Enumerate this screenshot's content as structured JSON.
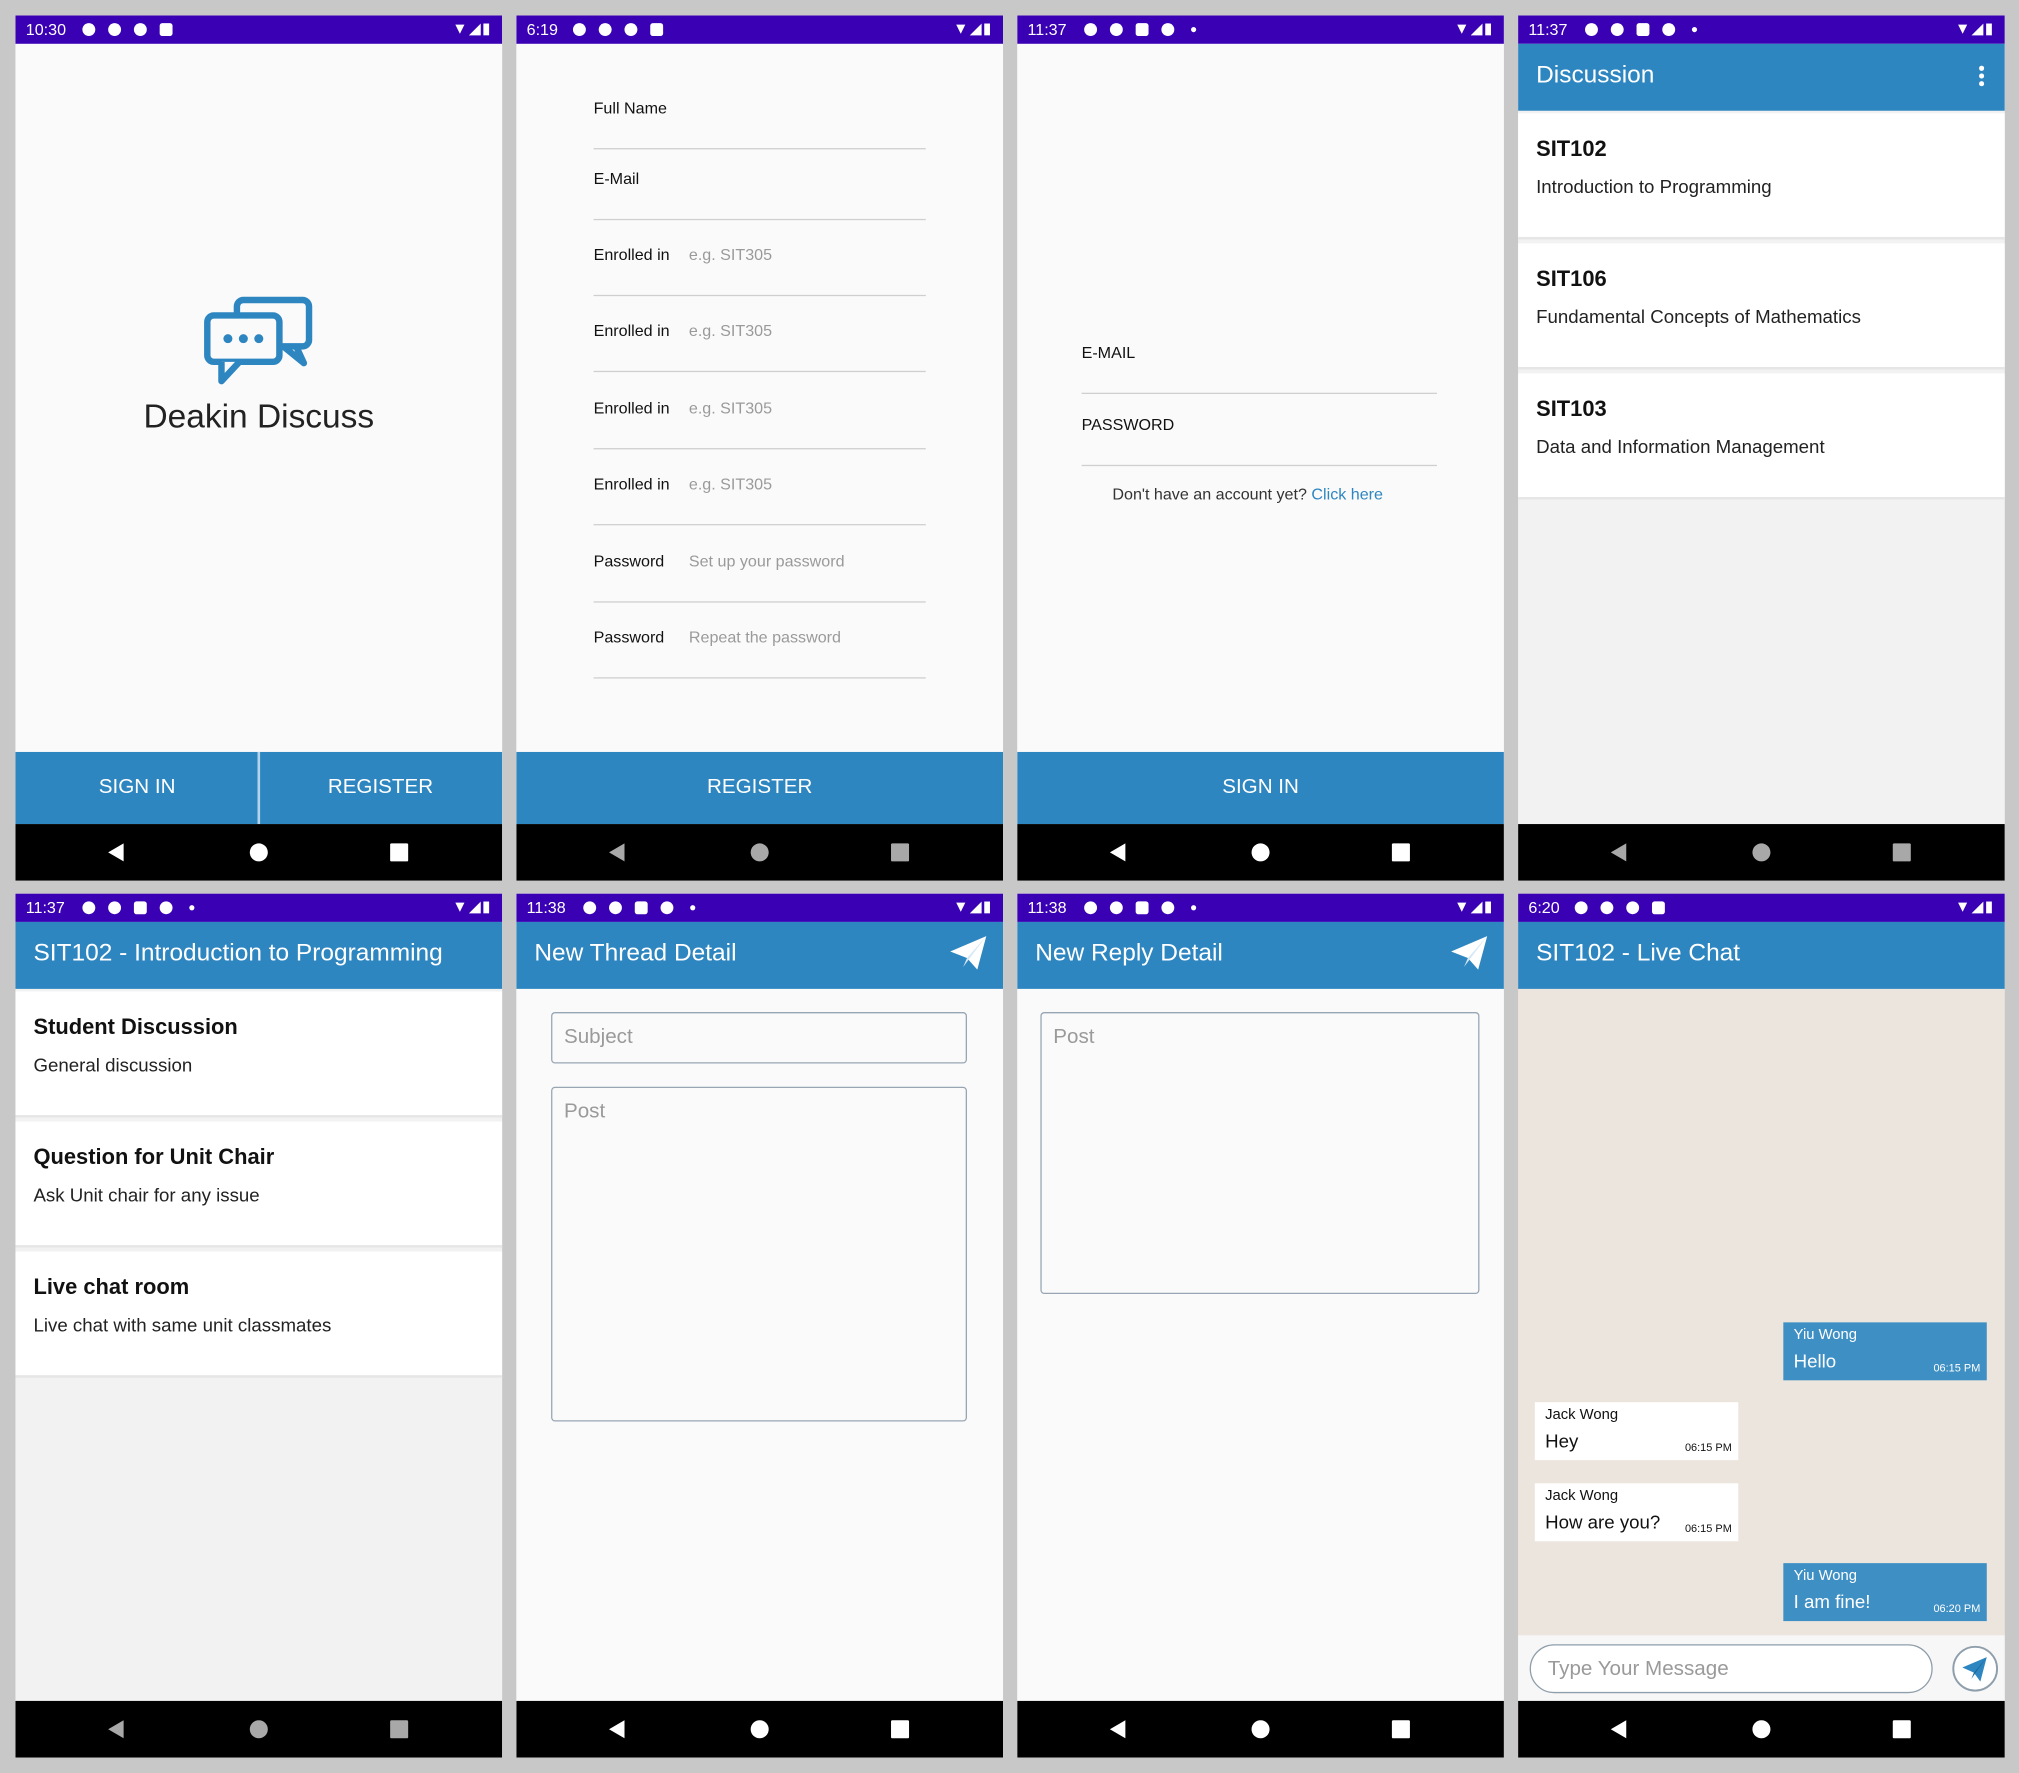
{
  "statusbar": {
    "times": [
      "10:30",
      "6:19",
      "11:37",
      "11:37",
      "11:37",
      "11:38",
      "11:38",
      "6:20"
    ],
    "right_icons": "▼◢▮"
  },
  "splash": {
    "logo_icon": "chat-bubbles-icon",
    "app_name": "Deakin Discuss",
    "sign_in_label": "SIGN IN",
    "register_label": "REGISTER"
  },
  "register": {
    "fields": [
      {
        "label": "Full Name",
        "placeholder": ""
      },
      {
        "label": "E-Mail",
        "placeholder": ""
      },
      {
        "label": "Enrolled in",
        "placeholder": "e.g. SIT305"
      },
      {
        "label": "Enrolled in",
        "placeholder": "e.g. SIT305"
      },
      {
        "label": "Enrolled in",
        "placeholder": "e.g. SIT305"
      },
      {
        "label": "Enrolled in",
        "placeholder": "e.g. SIT305"
      },
      {
        "label": "Password",
        "placeholder": "Set up your password"
      },
      {
        "label": "Password",
        "placeholder": "Repeat the password"
      }
    ],
    "submit_label": "REGISTER"
  },
  "login": {
    "email_label": "E-MAIL",
    "password_label": "PASSWORD",
    "no_account_text": "Don't have an account yet?",
    "click_here": "Click here",
    "sign_in_label": "SIGN IN"
  },
  "discussion": {
    "title": "Discussion",
    "units": [
      {
        "code": "SIT102",
        "name": "Introduction to Programming"
      },
      {
        "code": "SIT106",
        "name": "Fundamental Concepts of Mathematics"
      },
      {
        "code": "SIT103",
        "name": "Data and Information Management"
      }
    ]
  },
  "unit": {
    "title": "SIT102 - Introduction to Programming",
    "rooms": [
      {
        "title": "Student Discussion",
        "subtitle": "General discussion"
      },
      {
        "title": "Question for Unit Chair",
        "subtitle": "Ask Unit chair for any issue"
      },
      {
        "title": "Live chat room",
        "subtitle": "Live chat with same unit classmates"
      }
    ]
  },
  "new_thread": {
    "title": "New Thread Detail",
    "subject_placeholder": "Subject",
    "post_placeholder": "Post"
  },
  "new_reply": {
    "title": "New Reply Detail",
    "post_placeholder": "Post"
  },
  "live_chat": {
    "title": "SIT102 - Live Chat",
    "messages": [
      {
        "sender": "Yiu Wong",
        "text": "Hello",
        "time": "06:15 PM",
        "mine": true
      },
      {
        "sender": "Jack Wong",
        "text": "Hey",
        "time": "06:15 PM",
        "mine": false
      },
      {
        "sender": "Jack Wong",
        "text": "How are you?",
        "time": "06:15 PM",
        "mine": false
      },
      {
        "sender": "Yiu Wong",
        "text": "I am fine!",
        "time": "06:20 PM",
        "mine": true
      }
    ],
    "input_placeholder": "Type Your Message"
  },
  "colors": {
    "status_bar": "#3a00b4",
    "primary": "#2e86c1",
    "chat_background": "#ece5dd",
    "my_bubble": "#3d8fc4"
  }
}
